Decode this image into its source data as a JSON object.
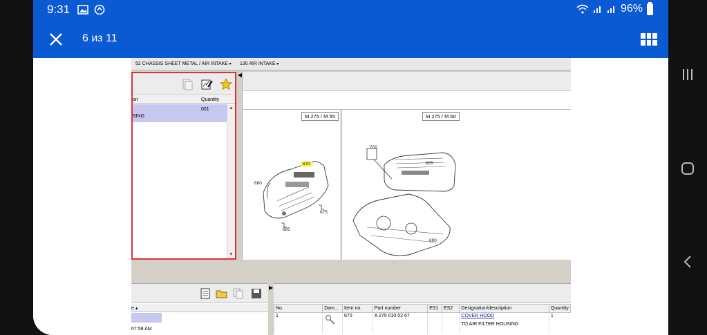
{
  "status_bar": {
    "time": "9:31",
    "battery_percent": "96%"
  },
  "app_bar": {
    "counter": "6 из 11",
    "accent_color": "#0a5ad4"
  },
  "screenshot": {
    "breadcrumbs": [
      "52 CHASSIS SHEET METAL / AIR INTAKE",
      "130 AIR INTAKE"
    ],
    "parts_list": {
      "headers": [
        "on",
        "Quantity"
      ],
      "row": {
        "desc": "SING",
        "qty": "001"
      }
    },
    "drawing": {
      "left_label": "M 275 / M 55",
      "right_label": "M 275 / M 60",
      "left_callouts": [
        "680",
        "670",
        "675",
        "685"
      ],
      "right_callouts": [
        "700",
        "685",
        "690"
      ]
    },
    "bottom_left": {
      "header": "e ▴",
      "date": "07:58 AM"
    },
    "parts_table": {
      "headers": [
        "No.",
        "Dam...",
        "Item no.",
        "Part number",
        "ES1",
        "ES2",
        "Designation/description",
        "Quantity"
      ],
      "row": {
        "no": "1",
        "item_no": "670",
        "part_number": "A 275 010 02 67",
        "designation": "COVER HOOD",
        "description": "TO AIR FILTER HOUSING",
        "quantity": "1"
      }
    }
  },
  "icons": [
    "close-icon",
    "grid-icon",
    "recents-icon",
    "home-icon",
    "back-icon"
  ]
}
